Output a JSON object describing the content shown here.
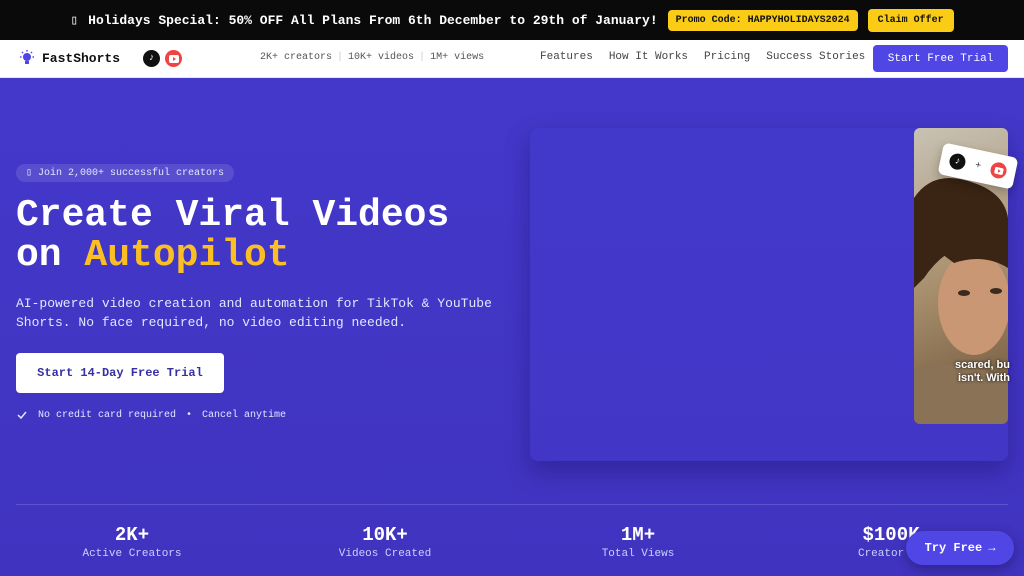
{
  "promo": {
    "icon": "gift-icon",
    "text": "Holidays Special: 50% OFF All Plans From 6th December to 29th of January!",
    "code": "Promo Code: HAPPYHOLIDAYS2024",
    "claim_label": "Claim Offer"
  },
  "nav": {
    "brand": "FastShorts",
    "stats": [
      "2K+ creators",
      "10K+ videos",
      "1M+ views"
    ],
    "links": [
      "Features",
      "How It Works",
      "Pricing",
      "Success Stories"
    ],
    "cta_label": "Start Free Trial"
  },
  "hero": {
    "badge": "Join 2,000+ successful creators",
    "title_line1": "Create Viral Videos",
    "title_line2_prefix": "on ",
    "title_accent": "Autopilot",
    "subtitle": "AI-powered video creation and automation for TikTok & YouTube Shorts. No face required, no video editing needed.",
    "cta_label": "Start 14-Day Free Trial",
    "meta1": "No credit card required",
    "meta_sep": "•",
    "meta2": "Cancel anytime"
  },
  "preview": {
    "caption_line1": "scared, bu",
    "caption_line2": "isn't. With",
    "plus": "+"
  },
  "stats": [
    {
      "value": "2K+",
      "label": "Active Creators"
    },
    {
      "value": "10K+",
      "label": "Videos Created"
    },
    {
      "value": "1M+",
      "label": "Total Views"
    },
    {
      "value": "$100K",
      "label": "Creator Ea"
    }
  ],
  "fab": {
    "label": "Try Free",
    "arrow": "→"
  },
  "colors": {
    "accent": "#fbbf24",
    "primary": "#4f46e5",
    "hero_bg": "#4338ca"
  }
}
